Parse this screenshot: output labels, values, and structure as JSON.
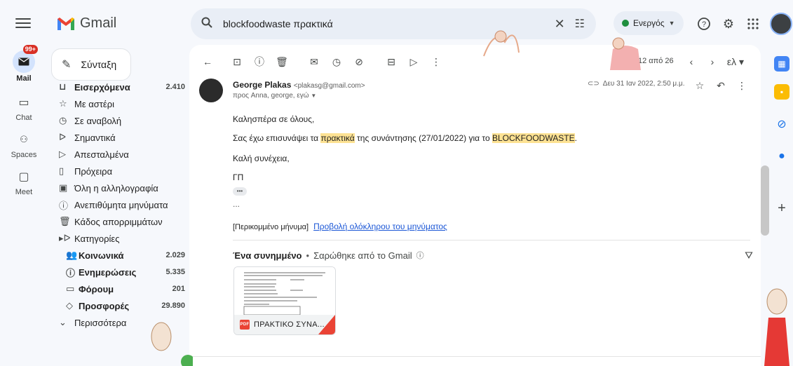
{
  "app": {
    "logo_text": "Gmail"
  },
  "search": {
    "query": "blockfoodwaste πρακτικά"
  },
  "status": {
    "label": "Ενεργός"
  },
  "rail": [
    {
      "label": "Mail",
      "badge": "99+"
    },
    {
      "label": "Chat"
    },
    {
      "label": "Spaces"
    },
    {
      "label": "Meet"
    }
  ],
  "compose": {
    "label": "Σύνταξη"
  },
  "nav": [
    {
      "label": "Εισερχόμενα",
      "count": "2.410",
      "icon": "inbox-icon",
      "glyph": "⊔",
      "bold": true
    },
    {
      "label": "Με αστέρι",
      "count": "",
      "icon": "star-icon",
      "glyph": "☆"
    },
    {
      "label": "Σε αναβολή",
      "count": "",
      "icon": "clock-icon",
      "glyph": "◷"
    },
    {
      "label": "Σημαντικά",
      "count": "",
      "icon": "label-important-icon",
      "glyph": "ᐅ"
    },
    {
      "label": "Απεσταλμένα",
      "count": "",
      "icon": "send-icon",
      "glyph": "▷"
    },
    {
      "label": "Πρόχειρα",
      "count": "",
      "icon": "draft-icon",
      "glyph": "▯"
    },
    {
      "label": "Όλη η αλληλογραφία",
      "count": "",
      "icon": "all-mail-icon",
      "glyph": "▣"
    },
    {
      "label": "Ανεπιθύμητα μηνύματα",
      "count": "",
      "icon": "spam-icon",
      "glyph": "ⓘ"
    },
    {
      "label": "Κάδος απορριμμάτων",
      "count": "",
      "icon": "trash-icon",
      "glyph": "🗑"
    },
    {
      "label": "Κατηγορίες",
      "count": "",
      "icon": "categories-icon",
      "glyph": "▸ᐅ"
    },
    {
      "label": "Κοινωνικά",
      "count": "2.029",
      "icon": "people-icon",
      "glyph": "👥",
      "bold": true,
      "indent": true
    },
    {
      "label": "Ενημερώσεις",
      "count": "5.335",
      "icon": "info-icon",
      "glyph": "ⓘ",
      "bold": true,
      "indent": true
    },
    {
      "label": "Φόρουμ",
      "count": "201",
      "icon": "forum-icon",
      "glyph": "▭",
      "bold": true,
      "indent": true
    },
    {
      "label": "Προσφορές",
      "count": "29.890",
      "icon": "tag-icon",
      "glyph": "◇",
      "bold": true,
      "indent": true
    },
    {
      "label": "Περισσότερα",
      "count": "",
      "icon": "chevron-down-icon",
      "glyph": "⌄"
    }
  ],
  "toolbar": {
    "pagination": "12 από 26"
  },
  "email": {
    "sender_name": "George Plakas",
    "sender_email": "<plakasg@gmail.com>",
    "recipients": "προς Anna, george, εγώ",
    "date": "Δευ 31 Ιαν 2022, 2:50 μ.μ.",
    "greeting": "Καλησπέρα σε όλους,",
    "line1_pre": "Σας έχω επισυνάψει τα ",
    "line1_hl1": "πρακτικά",
    "line1_mid": " της συνάντησης (27/01/2022) για το ",
    "line1_hl2": "BLOCKFOODWASTE",
    "line1_post": ".",
    "closing": "Καλή συνέχεια,",
    "signature": "ΓΠ",
    "ellipsis_btn": "•••",
    "trailing_dots": "...",
    "clipped_label": "[Περικομμένο μήνυμα]",
    "view_full_link": "Προβολή ολόκληρου του μηνύματος"
  },
  "attachments": {
    "heading": "Ένα συνημμένο",
    "scan_note": "Σαρώθηκε από το Gmail",
    "file_name": "ΠΡΑΚΤΙΚΟ ΣΥΝΑ..."
  },
  "colors": {
    "accent": "#0b57d0",
    "highlight": "#fde293",
    "pdf_red": "#ea4335",
    "online_green": "#1e8e3e"
  }
}
